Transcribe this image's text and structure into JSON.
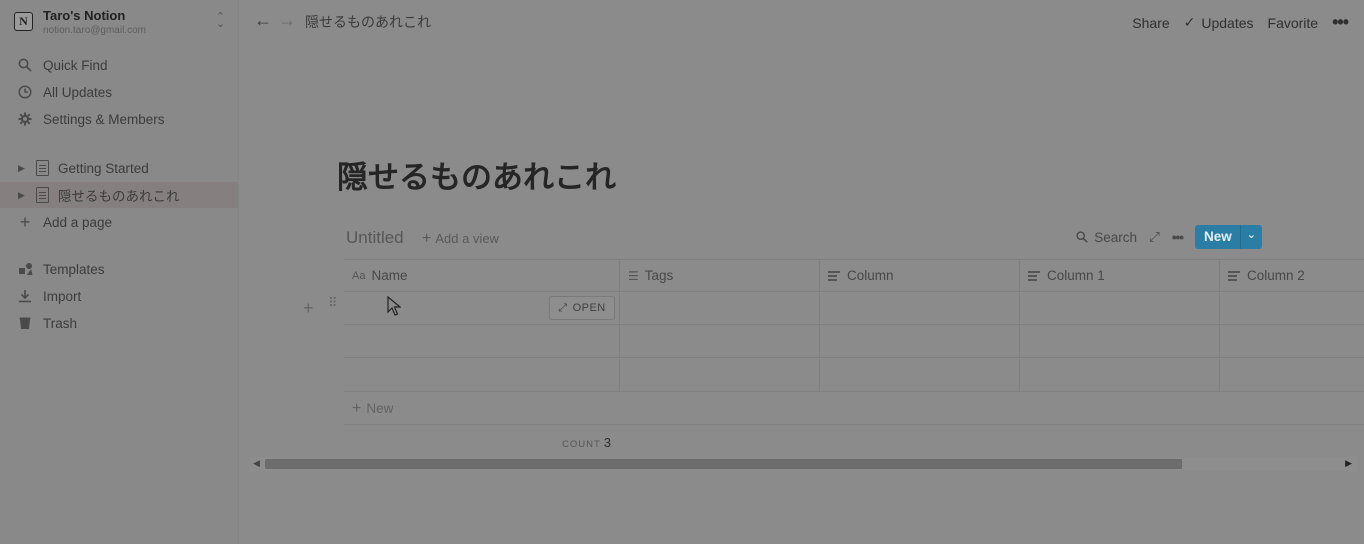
{
  "sidebar": {
    "workspace_name": "Taro's Notion",
    "workspace_email": "notion.taro@gmail.com",
    "nav": [
      {
        "label": "Quick Find",
        "icon": "search-icon"
      },
      {
        "label": "All Updates",
        "icon": "clock-icon"
      },
      {
        "label": "Settings & Members",
        "icon": "gear-icon"
      }
    ],
    "pages": [
      {
        "label": "Getting Started",
        "active": false
      },
      {
        "label": "隠せるものあれこれ",
        "active": true
      }
    ],
    "add_page": "Add a page",
    "bottom": [
      {
        "label": "Templates",
        "icon": "templates-icon"
      },
      {
        "label": "Import",
        "icon": "import-icon"
      },
      {
        "label": "Trash",
        "icon": "trash-icon"
      }
    ]
  },
  "topbar": {
    "breadcrumb": "隠せるものあれこれ",
    "share": "Share",
    "updates": "Updates",
    "favorite": "Favorite"
  },
  "page": {
    "title": "隠せるものあれこれ"
  },
  "database": {
    "title": "Untitled",
    "add_view": "Add a view",
    "search": "Search",
    "new_button": "New",
    "columns": [
      "Name",
      "Tags",
      "Column",
      "Column 1",
      "Column 2"
    ],
    "open_label": "OPEN",
    "new_row": "New",
    "count_label": "COUNT",
    "count_value": "3"
  },
  "colors": {
    "accent": "#2a7da5",
    "overlay_bg": "#8b8b8b"
  }
}
